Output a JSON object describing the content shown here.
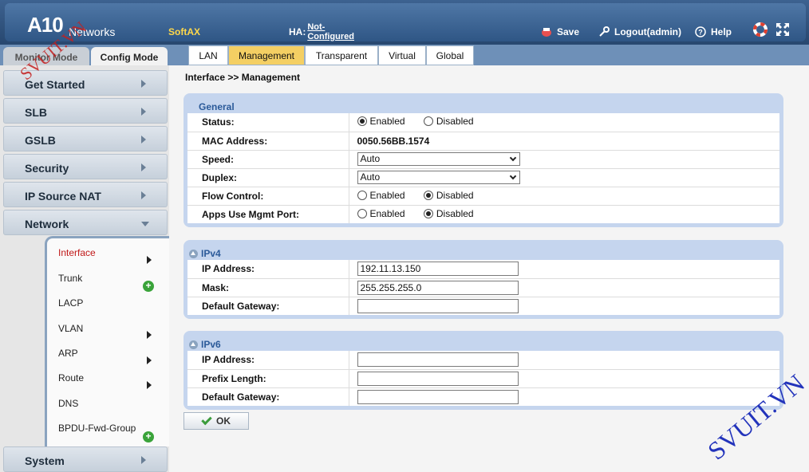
{
  "header": {
    "logo": "A10",
    "logo_sub": "Networks",
    "product": "SoftAX",
    "ha_label": "HA:",
    "ha_status_line1": "Not-",
    "ha_status_line2": "Configured",
    "save_label": "Save",
    "logout_label": "Logout(admin)",
    "help_label": "Help"
  },
  "modes": {
    "monitor": "Monitor Mode",
    "config": "Config Mode"
  },
  "sidebar": {
    "items": [
      {
        "label": "Get Started"
      },
      {
        "label": "SLB"
      },
      {
        "label": "GSLB"
      },
      {
        "label": "Security"
      },
      {
        "label": "IP Source NAT"
      },
      {
        "label": "Network"
      },
      {
        "label": "System"
      }
    ],
    "network_sub": [
      {
        "label": "Interface",
        "active": true
      },
      {
        "label": "Trunk"
      },
      {
        "label": "LACP"
      },
      {
        "label": "VLAN"
      },
      {
        "label": "ARP"
      },
      {
        "label": "Route"
      },
      {
        "label": "DNS"
      },
      {
        "label": "BPDU-Fwd-Group"
      }
    ]
  },
  "tabs": [
    "LAN",
    "Management",
    "Transparent",
    "Virtual",
    "Global"
  ],
  "active_tab": "Management",
  "breadcrumb": "Interface >> Management",
  "general": {
    "title": "General",
    "status_label": "Status:",
    "mac_label": "MAC Address:",
    "mac_value": "0050.56BB.1574",
    "speed_label": "Speed:",
    "speed_value": "Auto",
    "duplex_label": "Duplex:",
    "duplex_value": "Auto",
    "flow_label": "Flow Control:",
    "apps_label": "Apps Use Mgmt Port:",
    "enabled": "Enabled",
    "disabled": "Disabled"
  },
  "ipv4": {
    "title": "IPv4",
    "ip_label": "IP Address:",
    "ip_value": "192.11.13.150",
    "mask_label": "Mask:",
    "mask_value": "255.255.255.0",
    "gw_label": "Default Gateway:",
    "gw_value": ""
  },
  "ipv6": {
    "title": "IPv6",
    "ip_label": "IP Address:",
    "prefix_label": "Prefix Length:",
    "gw_label": "Default Gateway:"
  },
  "ok_label": "OK",
  "watermarks": {
    "top": "SVUIT.VN",
    "bottom": "SVUIT.VN"
  },
  "colors": {
    "active_tab": "#f4cf63",
    "active_nav": "#c01818",
    "header": "#2f5685"
  }
}
